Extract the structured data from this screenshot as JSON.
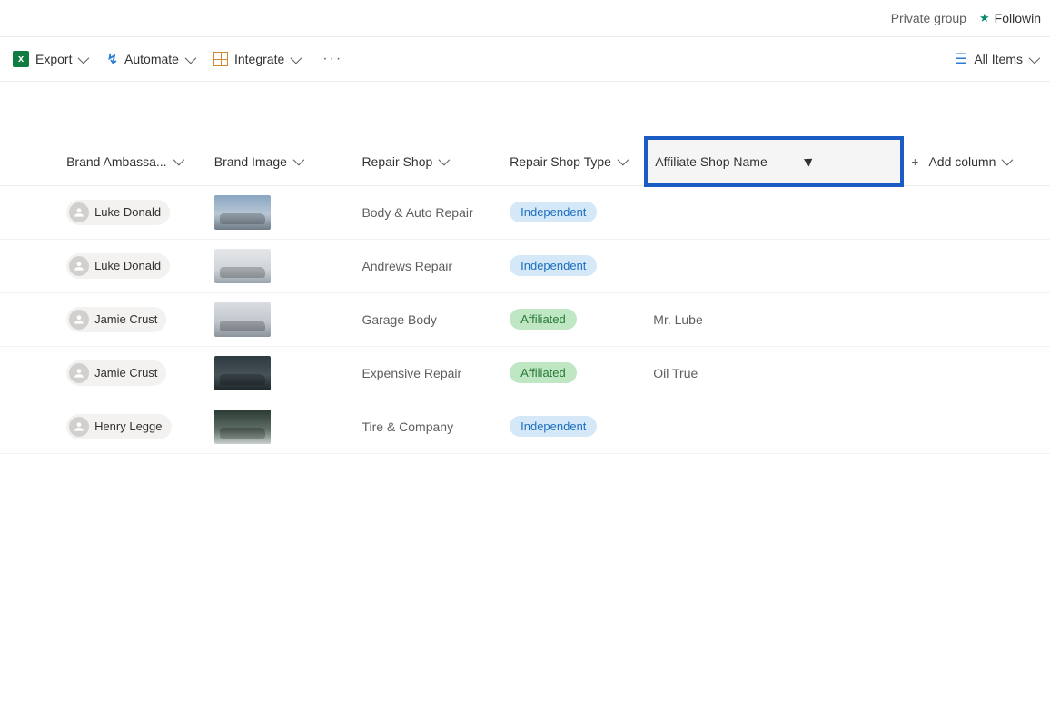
{
  "topbar": {
    "private_group": "Private group",
    "following": "Followin"
  },
  "toolbar": {
    "export": "Export",
    "automate": "Automate",
    "integrate": "Integrate",
    "all_items": "All Items"
  },
  "columns": {
    "brand_ambassador": "Brand Ambassa...",
    "brand_image": "Brand Image",
    "repair_shop": "Repair Shop",
    "repair_shop_type": "Repair Shop Type",
    "new_column_value": "Affiliate Shop Name",
    "add_column": "Add column"
  },
  "rows": [
    {
      "ambassador": "Luke Donald",
      "image_variant": "v1",
      "repair_shop": "Body & Auto Repair",
      "repair_shop_type": "Independent",
      "type_class": "independent",
      "affiliate_shop_name": ""
    },
    {
      "ambassador": "Luke Donald",
      "image_variant": "v2",
      "repair_shop": "Andrews Repair",
      "repair_shop_type": "Independent",
      "type_class": "independent",
      "affiliate_shop_name": ""
    },
    {
      "ambassador": "Jamie Crust",
      "image_variant": "v3",
      "repair_shop": "Garage Body",
      "repair_shop_type": "Affiliated",
      "type_class": "affiliated",
      "affiliate_shop_name": "Mr. Lube"
    },
    {
      "ambassador": "Jamie Crust",
      "image_variant": "v4",
      "repair_shop": "Expensive Repair",
      "repair_shop_type": "Affiliated",
      "type_class": "affiliated",
      "affiliate_shop_name": "Oil True"
    },
    {
      "ambassador": "Henry Legge",
      "image_variant": "v5",
      "repair_shop": "Tire & Company",
      "repair_shop_type": "Independent",
      "type_class": "independent",
      "affiliate_shop_name": ""
    }
  ]
}
